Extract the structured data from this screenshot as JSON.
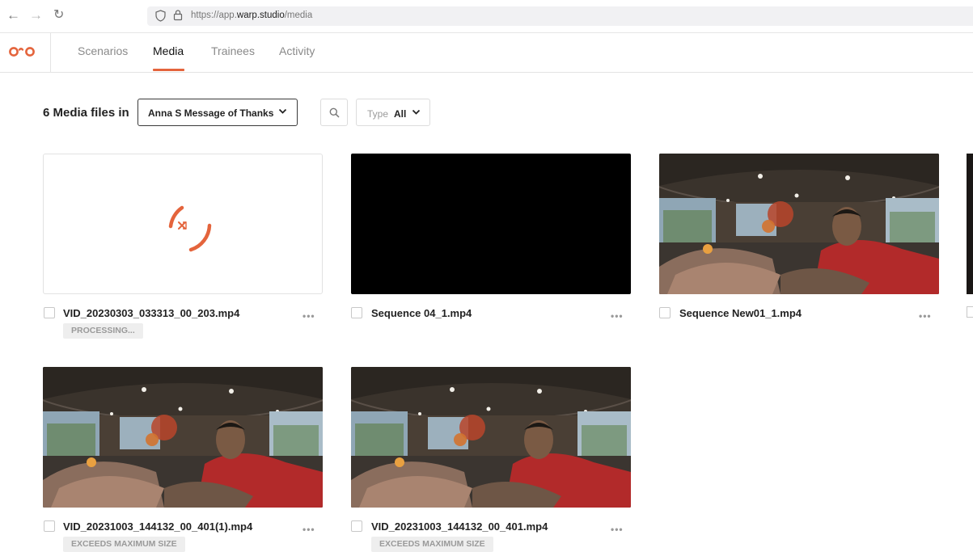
{
  "browser": {
    "back_icon": "arrow-left-icon",
    "forward_icon": "arrow-right-icon",
    "reload_icon": "reload-icon",
    "url_prefix": "https://app.",
    "url_host": "warp.studio",
    "url_path": "/media"
  },
  "nav": {
    "tabs": [
      {
        "label": "Scenarios"
      },
      {
        "label": "Media"
      },
      {
        "label": "Trainees"
      },
      {
        "label": "Activity"
      }
    ],
    "active_tab": "Media",
    "accent_color": "#e4643c"
  },
  "toolbar": {
    "count_label": "6 Media files in",
    "folder": "Anna S Message of Thanks",
    "type_label": "Type",
    "type_value": "All"
  },
  "media": [
    {
      "filename": "VID_20230303_033313_00_203.mp4",
      "status": "PROCESSING...",
      "thumbnail": "processing-spinner"
    },
    {
      "filename": "Sequence 04_1.mp4",
      "status": "",
      "thumbnail": "black"
    },
    {
      "filename": "Sequence New01_1.mp4",
      "status": "",
      "thumbnail": "360-panorama"
    },
    {
      "filename": "VID_20231003_144132_00_401(1).mp4",
      "status": "EXCEEDS MAXIMUM SIZE",
      "thumbnail": "360-panorama"
    },
    {
      "filename": "VID_20231003_144132_00_401.mp4",
      "status": "EXCEEDS MAXIMUM SIZE",
      "thumbnail": "360-panorama"
    }
  ],
  "more_label": "•••"
}
